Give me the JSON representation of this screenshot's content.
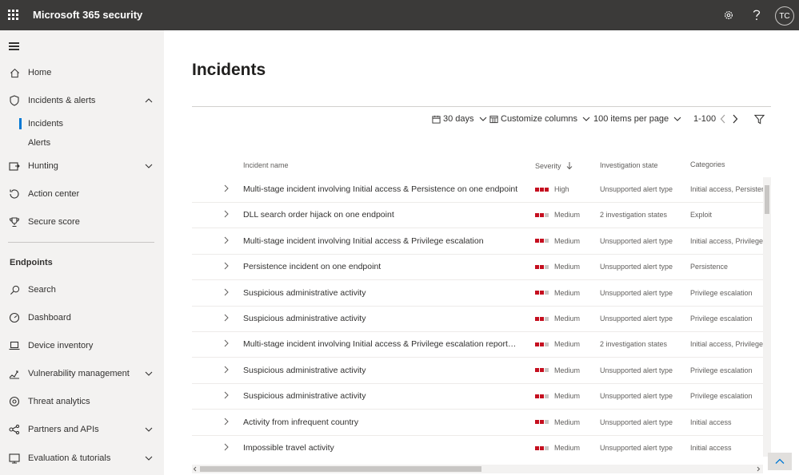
{
  "header": {
    "app_title": "Microsoft 365 security",
    "avatar_initials": "TC",
    "icons": [
      "waffle-icon",
      "gear-icon",
      "help-icon"
    ]
  },
  "sidebar": {
    "items": [
      {
        "label": "Home",
        "icon": "home-icon"
      },
      {
        "label": "Incidents & alerts",
        "icon": "shield-icon",
        "expanded": true,
        "children": [
          {
            "label": "Incidents",
            "selected": true
          },
          {
            "label": "Alerts"
          }
        ]
      },
      {
        "label": "Hunting",
        "icon": "hunting-icon"
      },
      {
        "label": "Action center",
        "icon": "action-center-icon"
      },
      {
        "label": "Secure score",
        "icon": "trophy-icon"
      }
    ],
    "section_endpoints": "Endpoints",
    "endpoint_items": [
      {
        "label": "Search",
        "icon": "search-icon"
      },
      {
        "label": "Dashboard",
        "icon": "dashboard-icon"
      },
      {
        "label": "Device inventory",
        "icon": "laptop-icon"
      },
      {
        "label": "Vulnerability management",
        "icon": "vulnerability-icon"
      },
      {
        "label": "Threat analytics",
        "icon": "threat-analytics-icon"
      },
      {
        "label": "Partners and APIs",
        "icon": "partners-icon"
      },
      {
        "label": "Evaluation & tutorials",
        "icon": "evaluation-icon"
      }
    ]
  },
  "main": {
    "title": "Incidents",
    "toolbar": {
      "date_range": "30 days",
      "customize_columns": "Customize columns",
      "items_per_page": "100 items per page",
      "pagination": "1-100"
    },
    "columns": {
      "name": "Incident name",
      "severity": "Severity",
      "investigation": "Investigation state",
      "categories": "Categories"
    },
    "rows": [
      {
        "name": "Multi-stage incident involving Initial access & Persistence on one endpoint",
        "severity": "High",
        "level": 3,
        "investigation": "Unsupported alert type",
        "categories": "Initial access, Persistence"
      },
      {
        "name": "DLL search order hijack on one endpoint",
        "severity": "Medium",
        "level": 2,
        "investigation": "2 investigation states",
        "categories": "Exploit"
      },
      {
        "name": "Multi-stage incident involving Initial access & Privilege escalation",
        "severity": "Medium",
        "level": 2,
        "investigation": "Unsupported alert type",
        "categories": "Initial access, Privilege escalation"
      },
      {
        "name": "Persistence incident on one endpoint",
        "severity": "Medium",
        "level": 2,
        "investigation": "Unsupported alert type",
        "categories": "Persistence"
      },
      {
        "name": "Suspicious administrative activity",
        "severity": "Medium",
        "level": 2,
        "investigation": "Unsupported alert type",
        "categories": "Privilege escalation"
      },
      {
        "name": "Suspicious administrative activity",
        "severity": "Medium",
        "level": 2,
        "investigation": "Unsupported alert type",
        "categories": "Privilege escalation"
      },
      {
        "name": "Multi-stage incident involving Initial access & Privilege escalation reporte...",
        "severity": "Medium",
        "level": 2,
        "investigation": "2 investigation states",
        "categories": "Initial access, Privilege escalation"
      },
      {
        "name": "Suspicious administrative activity",
        "severity": "Medium",
        "level": 2,
        "investigation": "Unsupported alert type",
        "categories": "Privilege escalation"
      },
      {
        "name": "Suspicious administrative activity",
        "severity": "Medium",
        "level": 2,
        "investigation": "Unsupported alert type",
        "categories": "Privilege escalation"
      },
      {
        "name": "Activity from infrequent country",
        "severity": "Medium",
        "level": 2,
        "investigation": "Unsupported alert type",
        "categories": "Initial access"
      },
      {
        "name": "Impossible travel activity",
        "severity": "Medium",
        "level": 2,
        "investigation": "Unsupported alert type",
        "categories": "Initial access"
      }
    ]
  },
  "colors": {
    "accent": "#0078d4",
    "severity": "#c50f1f",
    "topbar": "#3b3a39"
  }
}
